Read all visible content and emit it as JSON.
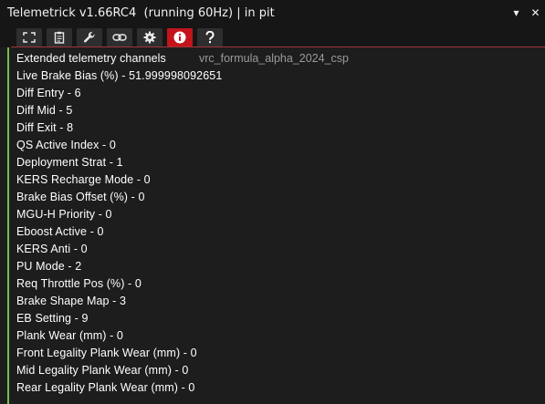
{
  "window": {
    "title": "Telemetrick v1.66RC4  (running 60Hz) | in pit",
    "minimize_glyph": "▾",
    "close_glyph": "✕"
  },
  "toolbar": {
    "buttons": [
      {
        "name": "fullscreen",
        "icon": "expand-icon",
        "active": false
      },
      {
        "name": "clipboard",
        "icon": "clipboard-icon",
        "active": false
      },
      {
        "name": "wrench",
        "icon": "wrench-icon",
        "active": false
      },
      {
        "name": "link",
        "icon": "link-icon",
        "active": false
      },
      {
        "name": "settings",
        "icon": "gear-icon",
        "active": false
      },
      {
        "name": "info",
        "icon": "info-icon",
        "active": true
      },
      {
        "name": "help",
        "icon": "question-icon",
        "active": false
      }
    ],
    "active_color": "#c4141b"
  },
  "panel": {
    "header": "Extended telemetry channels",
    "car_id": "vrc_formula_alpha_2024_csp",
    "accent_color": "#76c043",
    "channels": [
      "Live Brake Bias (%) - 51.999998092651",
      "Diff Entry - 6",
      "Diff Mid - 5",
      "Diff Exit - 8",
      "QS Active Index - 0",
      "Deployment Strat - 1",
      "KERS Recharge Mode - 0",
      "Brake Bias Offset (%) - 0",
      "MGU-H Priority - 0",
      "Eboost Active - 0",
      "KERS Anti - 0",
      "PU Mode - 2",
      "Req Throttle Pos (%) - 0",
      "Brake Shape Map - 3",
      "EB Setting - 9",
      "Plank Wear (mm) - 0",
      "Front Legality Plank Wear (mm) - 0",
      "Mid Legality Plank Wear (mm) - 0",
      "Rear Legality Plank Wear (mm) - 0"
    ]
  }
}
